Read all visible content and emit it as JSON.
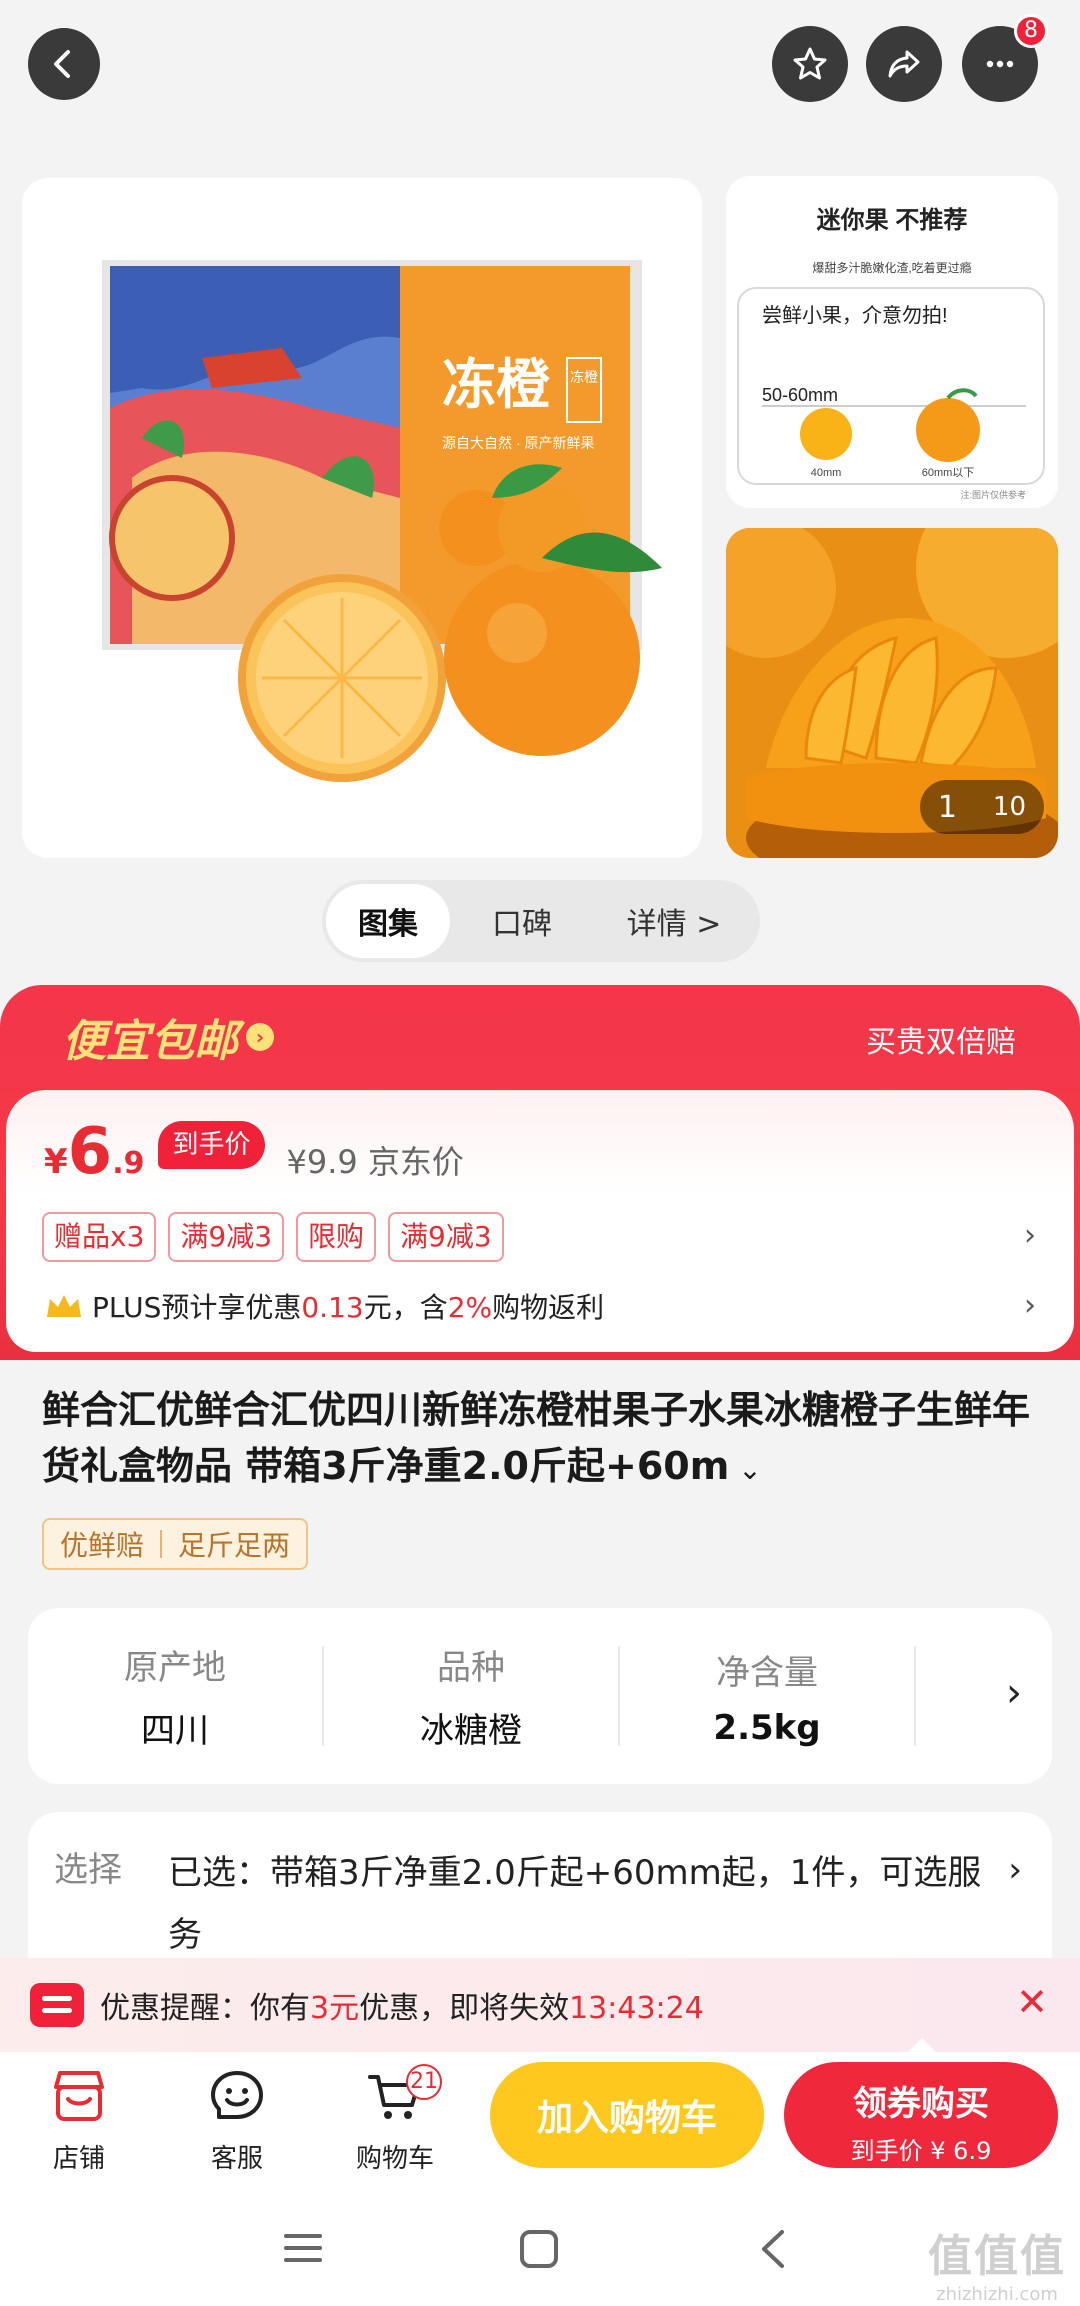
{
  "header": {
    "cart_count_badge": "8"
  },
  "gallery": {
    "main": {
      "box_title": "冻橙",
      "box_seal": "冻橙",
      "box_slogan": "源自大自然 · 原产新鲜果"
    },
    "side_top": {
      "heading": "迷你果  不推荐",
      "subheading": "爆甜多汁脆嫩化渣,吃着更过瘾",
      "note": "尝鲜小果，介意勿拍!",
      "size_range": "50-60mm",
      "size_a": "40mm",
      "size_b": "60mm以下",
      "footnote": "注:图片仅供参考"
    },
    "counter_current": "1",
    "counter_total": "10"
  },
  "segments": [
    {
      "label": "图集"
    },
    {
      "label": "口碑"
    },
    {
      "label": "详情 >"
    }
  ],
  "promo": {
    "banner_title": "便宜包邮",
    "banner_right": "买贵双倍赔",
    "currency": "¥",
    "price_int": "6",
    "price_dec": ".9",
    "price_tag": "到手价",
    "jd_price": "¥9.9  京东价",
    "tags": [
      "赠品x3",
      "满9减3",
      "限购",
      "满9减3"
    ],
    "plus_prefix": "PLUS预计享优惠",
    "plus_amount": "0.13",
    "plus_mid": "元，含",
    "plus_pct": "2%",
    "plus_suffix": "购物返利"
  },
  "product": {
    "title": "鲜合汇优鲜合汇优四川新鲜冻橙柑果子水果冰糖橙子生鲜年货礼盒物品 带箱3斤净重2.0斤起+60m",
    "badges": [
      "优鲜赔",
      "足斤足两"
    ]
  },
  "attributes": [
    {
      "key": "原产地",
      "value": "四川"
    },
    {
      "key": "品种",
      "value": "冰糖橙"
    },
    {
      "key": "净含量",
      "value": "2.5kg"
    }
  ],
  "selection": {
    "label": "选择",
    "value": "已选：带箱3斤净重2.0斤起+60mm起，1件，可选服务"
  },
  "reminder": {
    "prefix": "优惠提醒：你有",
    "amount": "3元",
    "middle": "优惠，即将失效",
    "countdown": "13:43:24"
  },
  "actions": {
    "shop": "店铺",
    "service": "客服",
    "cart": "购物车",
    "cart_badge": "21",
    "add_to_cart": "加入购物车",
    "buy_title": "领券购买",
    "buy_sub": "到手价 ¥ 6.9"
  },
  "watermark": {
    "brand": "值值值",
    "url": "zhizhizhi.com"
  },
  "colors": {
    "accent_red": "#f2213a",
    "accent_yellow": "#ffc81e",
    "promo_gold": "#ffe27a"
  }
}
